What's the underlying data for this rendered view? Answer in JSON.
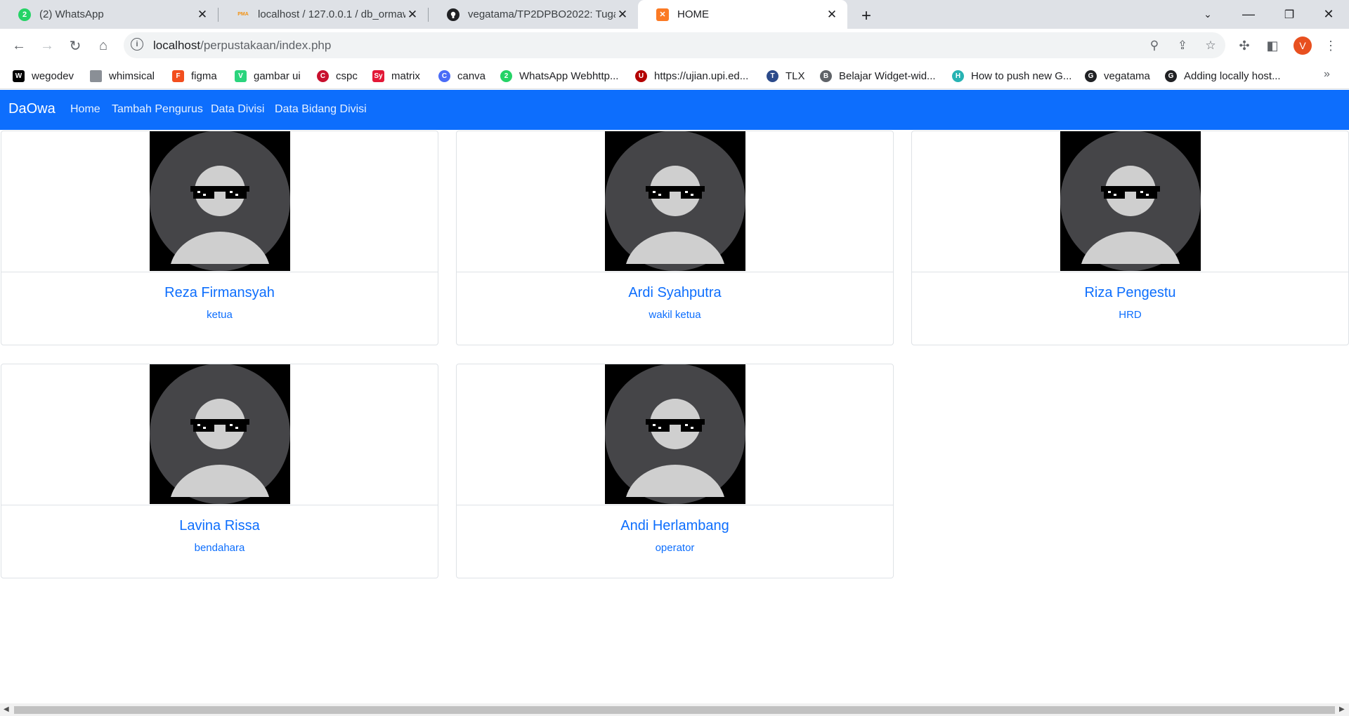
{
  "browser": {
    "tabs": [
      {
        "title": "(2) WhatsApp",
        "favicon": "whatsapp-icon",
        "badge": "2",
        "active": false
      },
      {
        "title": "localhost / 127.0.0.1 / db_ormawa",
        "favicon": "phpmyadmin-icon",
        "badge": "PMA",
        "active": false
      },
      {
        "title": "vegatama/TP2DPBO2022: Tugas",
        "favicon": "github-icon",
        "badge": "",
        "active": false
      },
      {
        "title": "HOME",
        "favicon": "xampp-icon",
        "badge": "",
        "active": true
      }
    ],
    "address": {
      "host": "localhost",
      "path": "/perpustakaan/index.php"
    },
    "profile_initial": "V",
    "bookmarks": [
      {
        "label": "wegodev",
        "icon": "W",
        "color": "#000000"
      },
      {
        "label": "whimsical",
        "icon": "",
        "color": "#8a8f96"
      },
      {
        "label": "figma",
        "icon": "F",
        "color": "#f24e1e"
      },
      {
        "label": "gambar ui",
        "icon": "V",
        "color": "#2bd47d"
      },
      {
        "label": "cspc",
        "icon": "C",
        "color": "#c8102e"
      },
      {
        "label": "matrix",
        "icon": "Sy",
        "color": "#e31837"
      },
      {
        "label": "canva",
        "icon": "C",
        "color": "#4a6cf7"
      },
      {
        "label": "WhatsApp Webhttp...",
        "icon": "2",
        "color": "#25d366"
      },
      {
        "label": "https://ujian.upi.ed...",
        "icon": "U",
        "color": "#b30000"
      },
      {
        "label": "TLX",
        "icon": "T",
        "color": "#2b4a8a"
      },
      {
        "label": "Belajar Widget-wid...",
        "icon": "B",
        "color": "#5f6368"
      },
      {
        "label": "How to push new G...",
        "icon": "H",
        "color": "#27b3b3"
      },
      {
        "label": "vegatama",
        "icon": "G",
        "color": "#202124"
      },
      {
        "label": "Adding locally host...",
        "icon": "G",
        "color": "#202124"
      }
    ]
  },
  "site": {
    "brand": "DaOwa",
    "nav": [
      "Home",
      "Tambah Pengurus",
      "Data Divisi",
      "Data Bidang Divisi"
    ],
    "accent": "#0d6efd"
  },
  "members": [
    {
      "name": "Reza Firmansyah",
      "role": "ketua"
    },
    {
      "name": "Ardi Syahputra",
      "role": "wakil ketua"
    },
    {
      "name": "Riza Pengestu",
      "role": "HRD"
    },
    {
      "name": "Lavina Rissa",
      "role": "bendahara"
    },
    {
      "name": "Andi Herlambang",
      "role": "operator"
    }
  ]
}
